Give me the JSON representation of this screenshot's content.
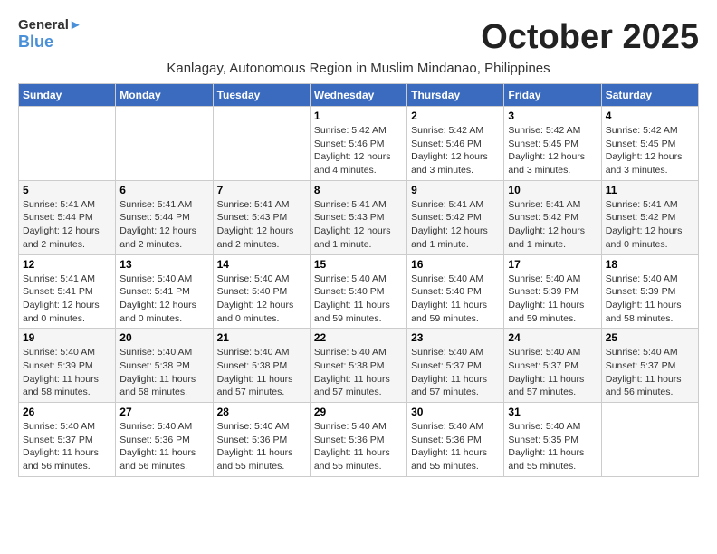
{
  "header": {
    "logo_line1": "General",
    "logo_line2": "Blue",
    "month_title": "October 2025",
    "subtitle": "Kanlagay, Autonomous Region in Muslim Mindanao, Philippines"
  },
  "days_of_week": [
    "Sunday",
    "Monday",
    "Tuesday",
    "Wednesday",
    "Thursday",
    "Friday",
    "Saturday"
  ],
  "weeks": [
    [
      {
        "day": "",
        "info": ""
      },
      {
        "day": "",
        "info": ""
      },
      {
        "day": "",
        "info": ""
      },
      {
        "day": "1",
        "info": "Sunrise: 5:42 AM\nSunset: 5:46 PM\nDaylight: 12 hours\nand 4 minutes."
      },
      {
        "day": "2",
        "info": "Sunrise: 5:42 AM\nSunset: 5:46 PM\nDaylight: 12 hours\nand 3 minutes."
      },
      {
        "day": "3",
        "info": "Sunrise: 5:42 AM\nSunset: 5:45 PM\nDaylight: 12 hours\nand 3 minutes."
      },
      {
        "day": "4",
        "info": "Sunrise: 5:42 AM\nSunset: 5:45 PM\nDaylight: 12 hours\nand 3 minutes."
      }
    ],
    [
      {
        "day": "5",
        "info": "Sunrise: 5:41 AM\nSunset: 5:44 PM\nDaylight: 12 hours\nand 2 minutes."
      },
      {
        "day": "6",
        "info": "Sunrise: 5:41 AM\nSunset: 5:44 PM\nDaylight: 12 hours\nand 2 minutes."
      },
      {
        "day": "7",
        "info": "Sunrise: 5:41 AM\nSunset: 5:43 PM\nDaylight: 12 hours\nand 2 minutes."
      },
      {
        "day": "8",
        "info": "Sunrise: 5:41 AM\nSunset: 5:43 PM\nDaylight: 12 hours\nand 1 minute."
      },
      {
        "day": "9",
        "info": "Sunrise: 5:41 AM\nSunset: 5:42 PM\nDaylight: 12 hours\nand 1 minute."
      },
      {
        "day": "10",
        "info": "Sunrise: 5:41 AM\nSunset: 5:42 PM\nDaylight: 12 hours\nand 1 minute."
      },
      {
        "day": "11",
        "info": "Sunrise: 5:41 AM\nSunset: 5:42 PM\nDaylight: 12 hours\nand 0 minutes."
      }
    ],
    [
      {
        "day": "12",
        "info": "Sunrise: 5:41 AM\nSunset: 5:41 PM\nDaylight: 12 hours\nand 0 minutes."
      },
      {
        "day": "13",
        "info": "Sunrise: 5:40 AM\nSunset: 5:41 PM\nDaylight: 12 hours\nand 0 minutes."
      },
      {
        "day": "14",
        "info": "Sunrise: 5:40 AM\nSunset: 5:40 PM\nDaylight: 12 hours\nand 0 minutes."
      },
      {
        "day": "15",
        "info": "Sunrise: 5:40 AM\nSunset: 5:40 PM\nDaylight: 11 hours\nand 59 minutes."
      },
      {
        "day": "16",
        "info": "Sunrise: 5:40 AM\nSunset: 5:40 PM\nDaylight: 11 hours\nand 59 minutes."
      },
      {
        "day": "17",
        "info": "Sunrise: 5:40 AM\nSunset: 5:39 PM\nDaylight: 11 hours\nand 59 minutes."
      },
      {
        "day": "18",
        "info": "Sunrise: 5:40 AM\nSunset: 5:39 PM\nDaylight: 11 hours\nand 58 minutes."
      }
    ],
    [
      {
        "day": "19",
        "info": "Sunrise: 5:40 AM\nSunset: 5:39 PM\nDaylight: 11 hours\nand 58 minutes."
      },
      {
        "day": "20",
        "info": "Sunrise: 5:40 AM\nSunset: 5:38 PM\nDaylight: 11 hours\nand 58 minutes."
      },
      {
        "day": "21",
        "info": "Sunrise: 5:40 AM\nSunset: 5:38 PM\nDaylight: 11 hours\nand 57 minutes."
      },
      {
        "day": "22",
        "info": "Sunrise: 5:40 AM\nSunset: 5:38 PM\nDaylight: 11 hours\nand 57 minutes."
      },
      {
        "day": "23",
        "info": "Sunrise: 5:40 AM\nSunset: 5:37 PM\nDaylight: 11 hours\nand 57 minutes."
      },
      {
        "day": "24",
        "info": "Sunrise: 5:40 AM\nSunset: 5:37 PM\nDaylight: 11 hours\nand 57 minutes."
      },
      {
        "day": "25",
        "info": "Sunrise: 5:40 AM\nSunset: 5:37 PM\nDaylight: 11 hours\nand 56 minutes."
      }
    ],
    [
      {
        "day": "26",
        "info": "Sunrise: 5:40 AM\nSunset: 5:37 PM\nDaylight: 11 hours\nand 56 minutes."
      },
      {
        "day": "27",
        "info": "Sunrise: 5:40 AM\nSunset: 5:36 PM\nDaylight: 11 hours\nand 56 minutes."
      },
      {
        "day": "28",
        "info": "Sunrise: 5:40 AM\nSunset: 5:36 PM\nDaylight: 11 hours\nand 55 minutes."
      },
      {
        "day": "29",
        "info": "Sunrise: 5:40 AM\nSunset: 5:36 PM\nDaylight: 11 hours\nand 55 minutes."
      },
      {
        "day": "30",
        "info": "Sunrise: 5:40 AM\nSunset: 5:36 PM\nDaylight: 11 hours\nand 55 minutes."
      },
      {
        "day": "31",
        "info": "Sunrise: 5:40 AM\nSunset: 5:35 PM\nDaylight: 11 hours\nand 55 minutes."
      },
      {
        "day": "",
        "info": ""
      }
    ]
  ]
}
